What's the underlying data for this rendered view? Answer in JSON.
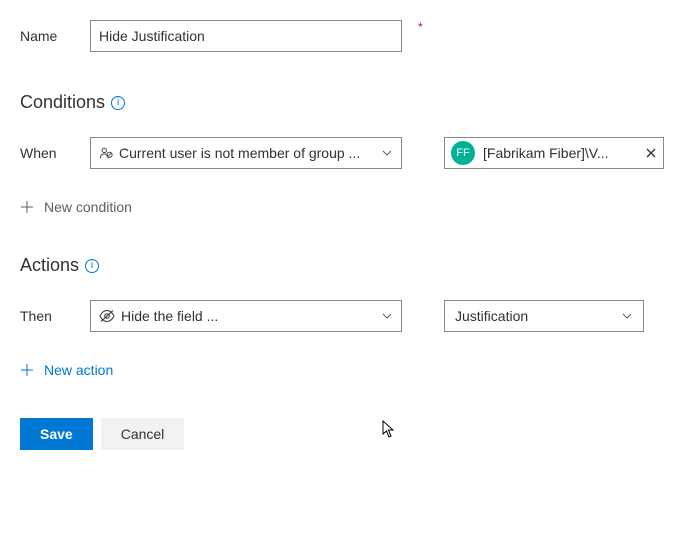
{
  "name": {
    "label": "Name",
    "value": "Hide Justification"
  },
  "conditions": {
    "heading": "Conditions",
    "when_label": "When",
    "condition_text": "Current user is not member of group ...",
    "group_chip": {
      "initials": "FF",
      "text": "[Fabrikam Fiber]\\V..."
    },
    "add_text": "New condition"
  },
  "actions": {
    "heading": "Actions",
    "then_label": "Then",
    "action_text": "Hide the field ...",
    "field_value": "Justification",
    "add_text": "New action"
  },
  "buttons": {
    "save": "Save",
    "cancel": "Cancel"
  }
}
